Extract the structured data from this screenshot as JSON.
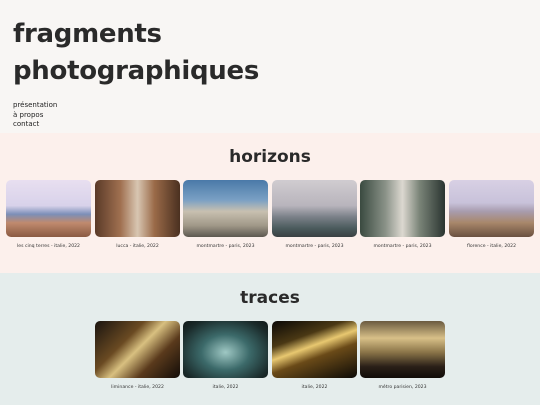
{
  "site": {
    "title": "fragments photographiques"
  },
  "nav": {
    "items": [
      "présentation",
      "à propos",
      "contact"
    ]
  },
  "horizons": {
    "title": "horizons",
    "photos": [
      {
        "caption": "les cinq terres - italie, 2022"
      },
      {
        "caption": "lucca - italie, 2022"
      },
      {
        "caption": "montmartre - paris, 2023"
      },
      {
        "caption": "montmartre - paris, 2023"
      },
      {
        "caption": "montmartre - paris, 2023"
      },
      {
        "caption": "florence - italie, 2022"
      }
    ]
  },
  "traces": {
    "title": "traces",
    "photos": [
      {
        "caption": "liminance - italie, 2022"
      },
      {
        "caption": "italie, 2022"
      },
      {
        "caption": "italie, 2022"
      },
      {
        "caption": "métro parisien, 2023"
      }
    ]
  }
}
